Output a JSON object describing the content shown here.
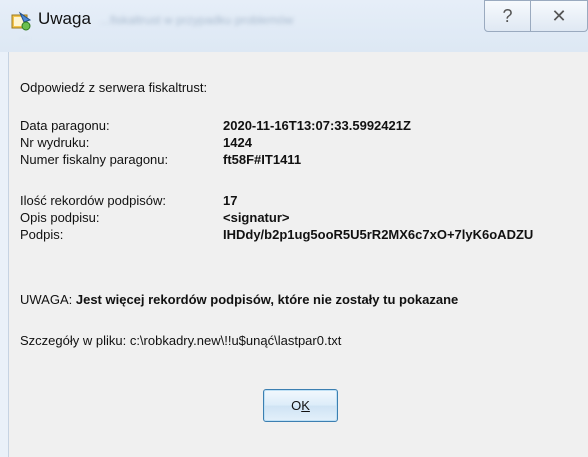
{
  "window": {
    "title": "Uwaga",
    "title_obscured": "...fiskaltrust w przypadku problemów",
    "title_obscured_line2": "...",
    "help_glyph": "?",
    "close_glyph": "✕"
  },
  "message": {
    "intro": "Odpowiedź z serwera fiskaltrust:",
    "fields": [
      {
        "label": "Data paragonu:",
        "value": "2020-11-16T13:07:33.5992421Z"
      },
      {
        "label": "Nr wydruku:",
        "value": "1424"
      },
      {
        "label": "Numer fiskalny paragonu:",
        "value": "ft58F#IT1411"
      },
      {
        "label": "Ilość rekordów podpisów:",
        "value": "17"
      },
      {
        "label": "Opis podpisu:",
        "value": "<signatur>"
      },
      {
        "label": "Podpis:",
        "value": "IHDdy/b2p1ug5ooR5U5rR2MX6c7xO+7lyK6oADZU"
      }
    ],
    "warning_prefix": "UWAGA: ",
    "warning_text": "Jest więcej rekordów podpisów, które nie zostały tu pokazane",
    "details": "Szczegóły w pliku: c:\\robkadry.new\\!!u$unąć\\lastpar0.txt"
  },
  "buttons": {
    "ok_before": "O",
    "ok_underlined": "K"
  }
}
